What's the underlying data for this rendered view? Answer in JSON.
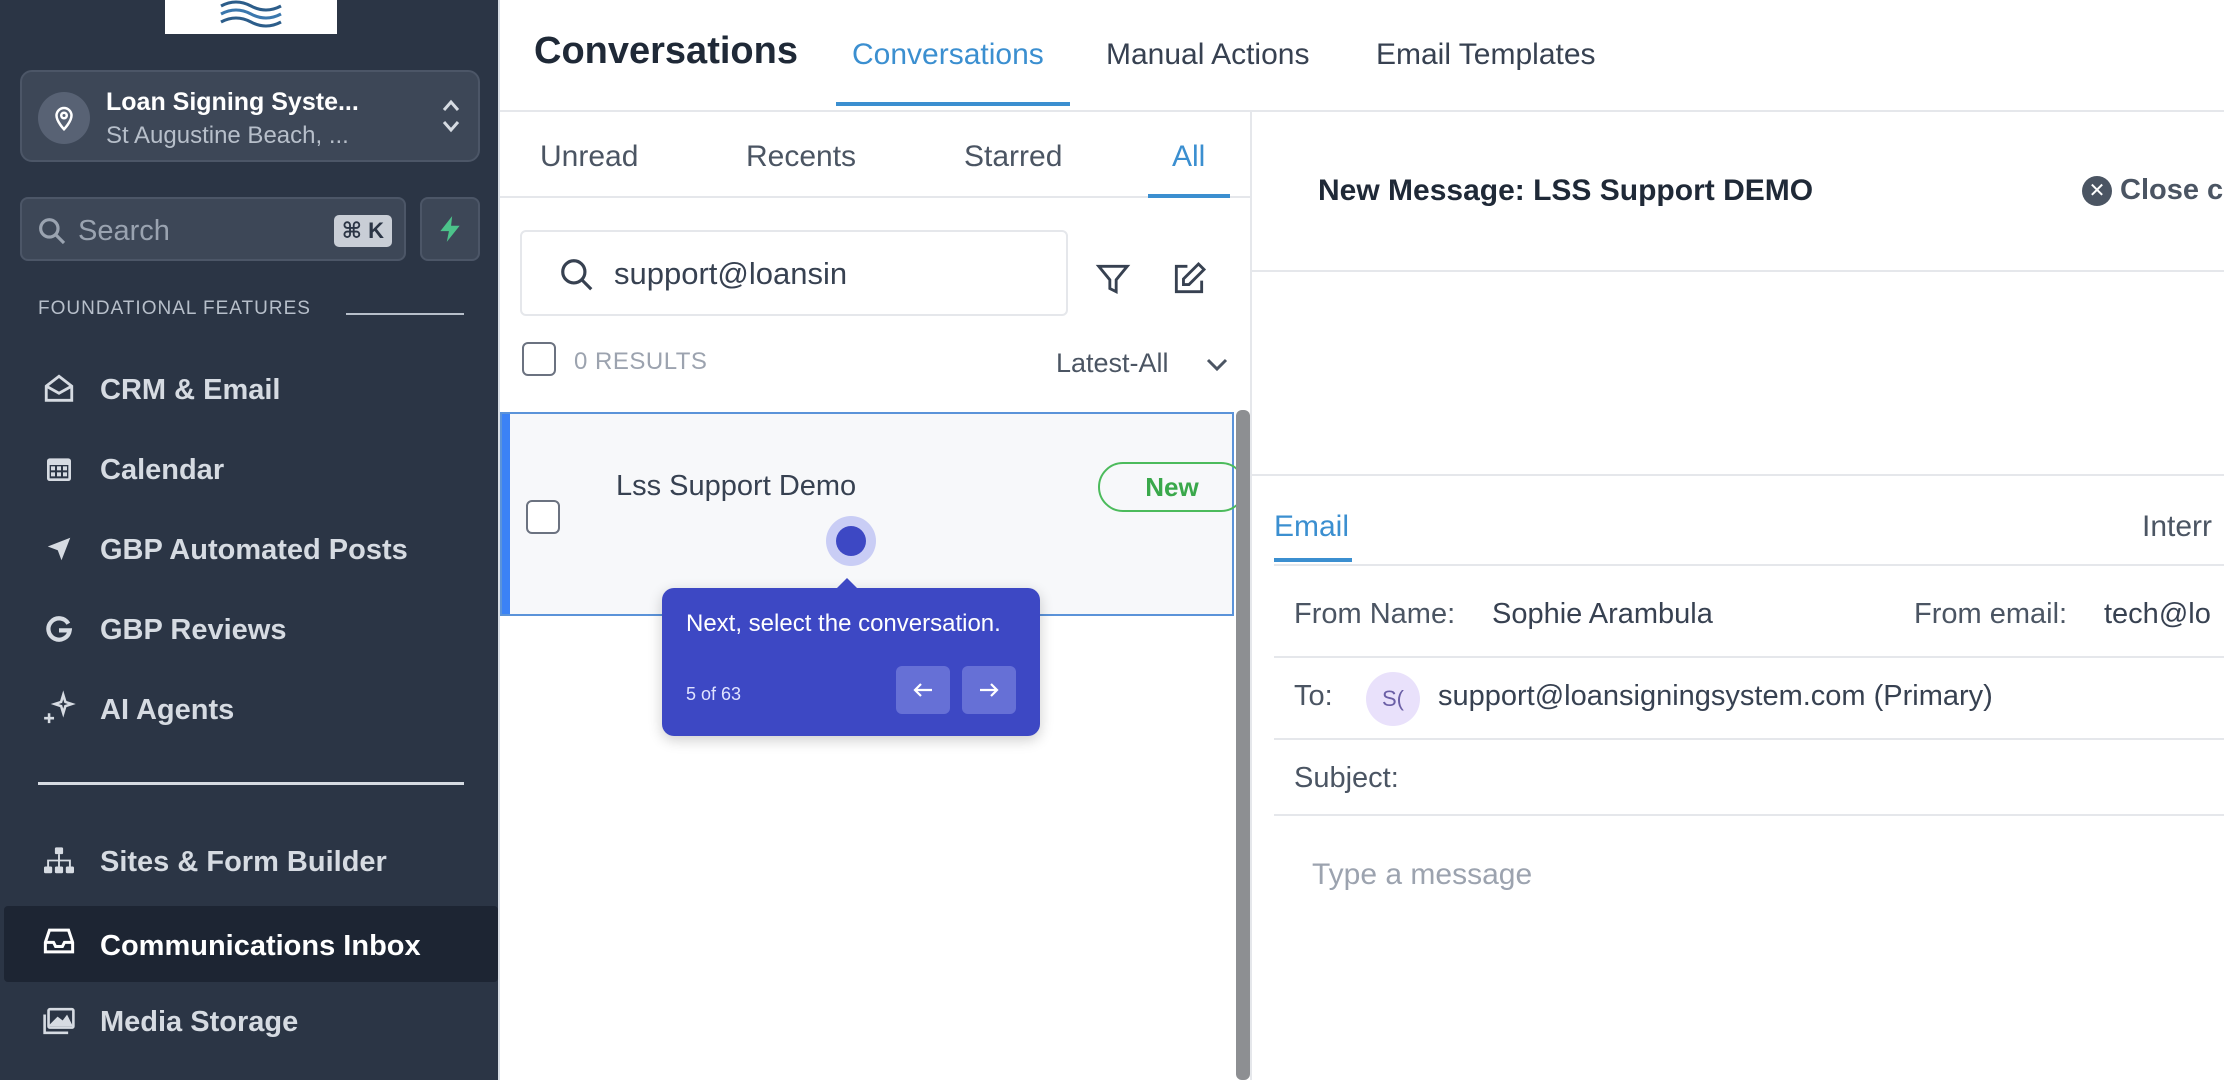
{
  "sidebar": {
    "location": {
      "name": "Loan Signing Syste...",
      "address": "St Augustine Beach, ..."
    },
    "search": {
      "placeholder": "Search",
      "shortcut": "⌘ K"
    },
    "section_label": "FOUNDATIONAL FEATURES",
    "items": [
      {
        "label": "CRM & Email",
        "icon": "envelope-open-icon"
      },
      {
        "label": "Calendar",
        "icon": "calendar-icon"
      },
      {
        "label": "GBP Automated Posts",
        "icon": "send-arrow-icon"
      },
      {
        "label": "GBP Reviews",
        "icon": "google-icon"
      },
      {
        "label": "AI Agents",
        "icon": "sparkle-icon"
      },
      {
        "label": "Sites & Form Builder",
        "icon": "sitemap-icon"
      },
      {
        "label": "Communications Inbox",
        "icon": "inbox-icon",
        "active": true
      },
      {
        "label": "Media Storage",
        "icon": "images-icon"
      }
    ]
  },
  "header": {
    "title": "Conversations",
    "tabs": [
      {
        "label": "Conversations",
        "active": true
      },
      {
        "label": "Manual Actions"
      },
      {
        "label": "Email Templates"
      }
    ]
  },
  "list": {
    "filters": [
      {
        "label": "Unread"
      },
      {
        "label": "Recents"
      },
      {
        "label": "Starred"
      },
      {
        "label": "All",
        "active": true
      }
    ],
    "search_value": "support@loansin",
    "results": "0 RESULTS",
    "sort": "Latest-All",
    "conversations": [
      {
        "name": "Lss Support Demo",
        "badge": "New"
      }
    ]
  },
  "tour": {
    "text": "Next, select the conversation.",
    "step": "5 of 63"
  },
  "message": {
    "title": "New Message: LSS Support DEMO",
    "close_label": "Close c",
    "tabs": [
      {
        "label": "Email",
        "active": true
      },
      {
        "label": "Interr"
      }
    ],
    "from_name_label": "From Name:",
    "from_name": "Sophie Arambula",
    "from_email_label": "From email:",
    "from_email": "tech@lo",
    "to_label": "To:",
    "to_initials": "S(",
    "to_value": "support@loansigningsystem.com (Primary)",
    "subject_label": "Subject:",
    "body_placeholder": "Type a message"
  },
  "colors": {
    "sidebar_bg": "#2b3545",
    "accent": "#3b8fd0",
    "tour_bg": "#3d48c4",
    "badge_green": "#3aa84b"
  }
}
